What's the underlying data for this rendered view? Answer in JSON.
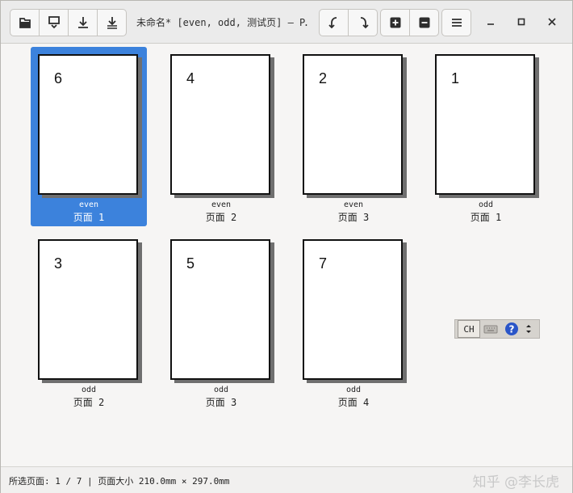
{
  "window": {
    "title": "未命名* [even, odd, 测试页] — P…"
  },
  "toolbar": {
    "left_buttons": [
      "open-icon",
      "save-icon",
      "export-icon",
      "export-all-icon"
    ],
    "middle_buttons": [
      "rotate-left-icon",
      "rotate-right-icon"
    ],
    "zoom_buttons": [
      "zoom-in-icon",
      "zoom-out-icon"
    ],
    "menu_button": "hamburger-menu-icon"
  },
  "pages": [
    {
      "number": "6",
      "file": "even",
      "label": "页面 1",
      "selected": true
    },
    {
      "number": "4",
      "file": "even",
      "label": "页面 2",
      "selected": false
    },
    {
      "number": "2",
      "file": "even",
      "label": "页面 3",
      "selected": false
    },
    {
      "number": "1",
      "file": "odd",
      "label": "页面 1",
      "selected": false
    },
    {
      "number": "3",
      "file": "odd",
      "label": "页面 2",
      "selected": false
    },
    {
      "number": "5",
      "file": "odd",
      "label": "页面 3",
      "selected": false
    },
    {
      "number": "7",
      "file": "odd",
      "label": "页面 4",
      "selected": false
    }
  ],
  "ime": {
    "lang": "CH"
  },
  "status": {
    "text": "所选页面: 1 / 7 | 页面大小 210.0mm × 297.0mm"
  },
  "watermark": "知乎 @李长虎",
  "colors": {
    "selection": "#3c82dc"
  }
}
